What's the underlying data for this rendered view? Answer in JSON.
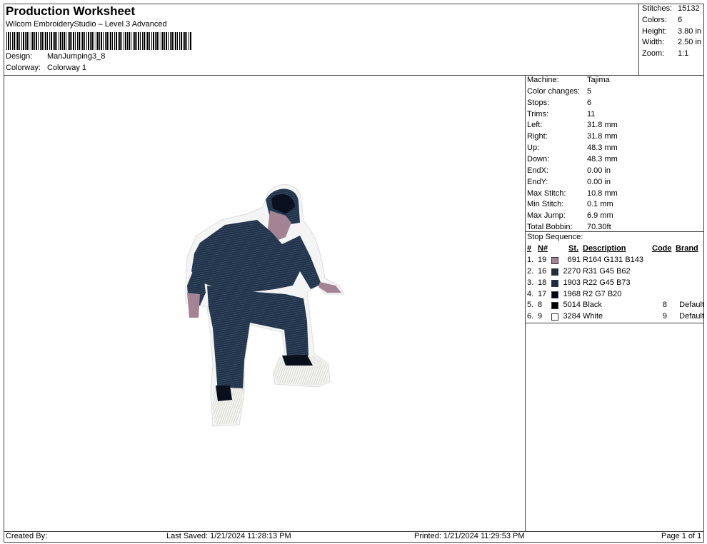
{
  "header": {
    "title": "Production Worksheet",
    "software": "Wilcom EmbroideryStudio – Level 3 Advanced",
    "design_label": "Design:",
    "design_value": "ManJumping3_8",
    "colorway_label": "Colorway:",
    "colorway_value": "Colorway 1"
  },
  "stats": [
    {
      "label": "Stitches:",
      "value": "15132"
    },
    {
      "label": "Colors:",
      "value": "6"
    },
    {
      "label": "Height:",
      "value": "3.80 in"
    },
    {
      "label": "Width:",
      "value": "2.50 in"
    },
    {
      "label": "Zoom:",
      "value": "1:1"
    }
  ],
  "machine_info": [
    {
      "label": "Machine:",
      "value": "Tajima"
    },
    {
      "label": "Color changes:",
      "value": "5"
    },
    {
      "label": "Stops:",
      "value": "6"
    },
    {
      "label": "Trims:",
      "value": "11"
    },
    {
      "label": "Left:",
      "value": "31.8 mm"
    },
    {
      "label": "Right:",
      "value": "31.8 mm"
    },
    {
      "label": "Up:",
      "value": "48.3 mm"
    },
    {
      "label": "Down:",
      "value": "48.3 mm"
    },
    {
      "label": "EndX:",
      "value": "0.00 in"
    },
    {
      "label": "EndY:",
      "value": "0.00 in"
    },
    {
      "label": "Max Stitch:",
      "value": "10.8 mm"
    },
    {
      "label": "Min Stitch:",
      "value": "0.1 mm"
    },
    {
      "label": "Max Jump:",
      "value": "6.9 mm"
    },
    {
      "label": "Total Bobbin:",
      "value": "70.30ft"
    }
  ],
  "stop_sequence": {
    "title": "Stop Sequence:",
    "headers": {
      "num": "#",
      "n": "N#",
      "st": "St.",
      "desc": "Description",
      "code": "Code",
      "brand": "Brand"
    },
    "rows": [
      {
        "num": "1.",
        "n": "19",
        "color": "#A48394",
        "st": "691",
        "desc": "R164 G131 B143",
        "code": "",
        "brand": ""
      },
      {
        "num": "2.",
        "n": "16",
        "color": "#1F2D3E",
        "st": "2270",
        "desc": "R31 G45 B62",
        "code": "",
        "brand": ""
      },
      {
        "num": "3.",
        "n": "18",
        "color": "#162D49",
        "st": "1903",
        "desc": "R22 G45 B73",
        "code": "",
        "brand": ""
      },
      {
        "num": "4.",
        "n": "17",
        "color": "#020714",
        "st": "1968",
        "desc": "R2 G7 B20",
        "code": "",
        "brand": ""
      },
      {
        "num": "5.",
        "n": "8",
        "color": "#000000",
        "st": "5014",
        "desc": "Black",
        "code": "8",
        "brand": "Default"
      },
      {
        "num": "6.",
        "n": "9",
        "color": "#FFFFFF",
        "st": "3284",
        "desc": "White",
        "code": "9",
        "brand": "Default"
      }
    ]
  },
  "footer": {
    "created_by": "Created By:",
    "last_saved": "Last Saved: 1/21/2024 11:28:13 PM",
    "printed": "Printed: 1/21/2024 11:29:53 PM",
    "page": "Page 1 of 1"
  }
}
